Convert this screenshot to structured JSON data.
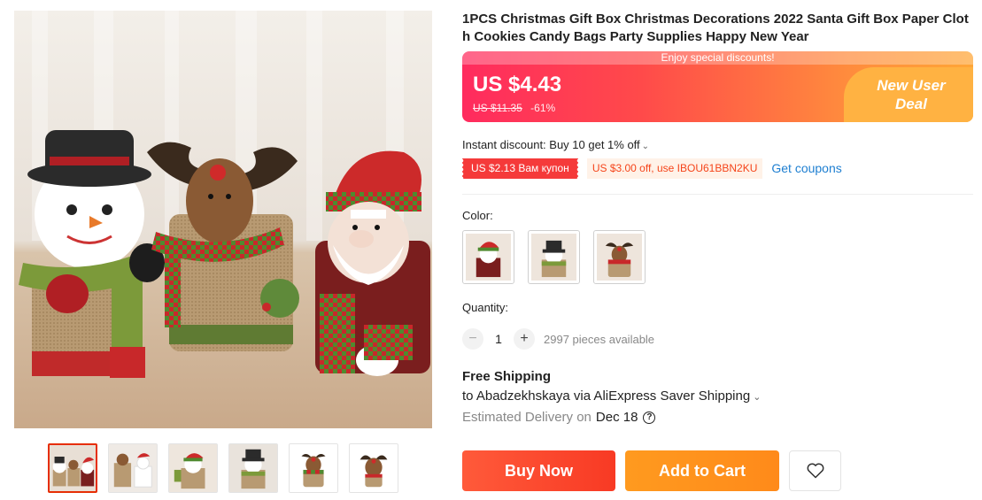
{
  "product": {
    "title": "1PCS Christmas Gift Box Christmas Decorations 2022 Santa Gift Box Paper Cloth Cookies Candy Bags Party Supplies Happy New Year",
    "main_image_icon": "christmas-gift-box-dolls-photo"
  },
  "price": {
    "promo_strip": "Enjoy special discounts!",
    "current": "US $4.43",
    "original": "US $11.35",
    "discount": "-61%",
    "new_user_line1": "New User",
    "new_user_line2": "Deal"
  },
  "discounts": {
    "instant": "Instant discount: Buy 10 get 1% off",
    "coupon_red": "US $2.13 Вам купон",
    "coupon_orange": "US $3.00 off, use IBOU61BBN2KU",
    "get_coupons": "Get coupons"
  },
  "color": {
    "label": "Color:",
    "options": [
      "santa",
      "snowman",
      "reindeer"
    ]
  },
  "quantity": {
    "label": "Quantity:",
    "minus": "−",
    "plus": "+",
    "value": "1",
    "available": "2997 pieces available"
  },
  "shipping": {
    "title": "Free Shipping",
    "destination": "to Abadzekhskaya via AliExpress Saver Shipping",
    "estimated_label": "Estimated Delivery on",
    "estimated_date": "Dec 18"
  },
  "actions": {
    "buy_now": "Buy Now",
    "add_to_cart": "Add to Cart"
  },
  "gallery": {
    "thumbnails": [
      "trio",
      "jar-bags",
      "santa",
      "snowman",
      "reindeer-a",
      "reindeer-b"
    ],
    "active_index": 0
  },
  "colors": {
    "accent_red": "#e62e04",
    "buy_now": "#f83a24",
    "add_to_cart": "#ff8a1a",
    "coupon_link": "#1e7fd1"
  }
}
